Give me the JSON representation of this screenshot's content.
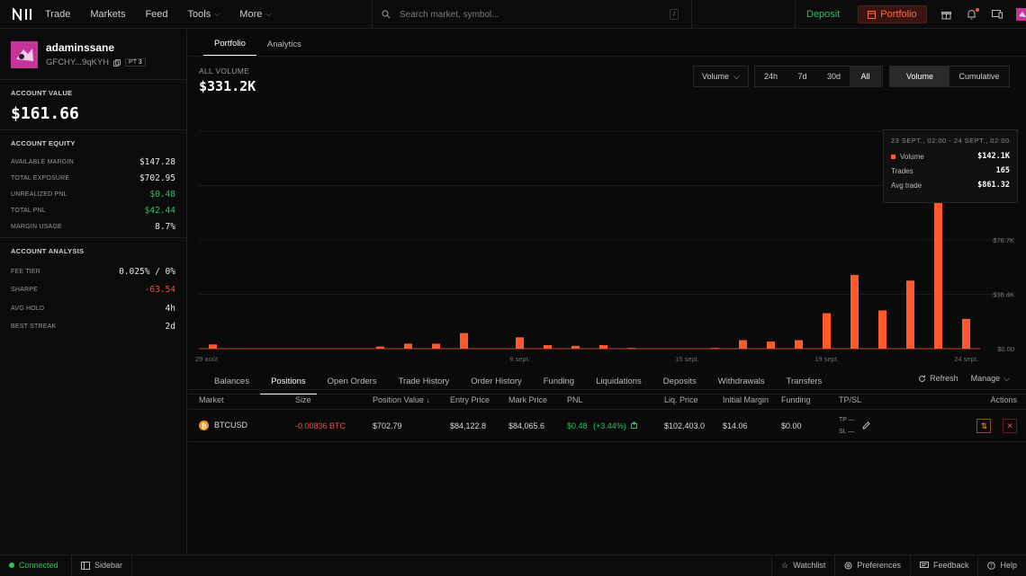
{
  "nav": {
    "items": [
      {
        "label": "Trade"
      },
      {
        "label": "Markets"
      },
      {
        "label": "Feed"
      },
      {
        "label": "Tools"
      },
      {
        "label": "More"
      }
    ],
    "search_placeholder": "Search market, symbol...",
    "search_shortcut": "/",
    "deposit_label": "Deposit",
    "portfolio_label": "Portfolio"
  },
  "profile": {
    "username": "adaminssane",
    "wallet": "GFCHY...9qKYH",
    "pt_label": "PT",
    "pt_value": "3"
  },
  "account": {
    "value_title": "ACCOUNT VALUE",
    "value": "$161.66",
    "equity_title": "ACCOUNT EQUITY",
    "equity_rows": [
      {
        "label": "AVAILABLE MARGIN",
        "value": "$147.28"
      },
      {
        "label": "TOTAL EXPOSURE",
        "value": "$702.95"
      },
      {
        "label": "UNREALIZED PNL",
        "value": "$0.48"
      },
      {
        "label": "TOTAL PNL",
        "value": "$42.44"
      },
      {
        "label": "MARGIN USAGE",
        "value": "8.7%"
      }
    ],
    "analysis_title": "ACCOUNT ANALYSIS",
    "analysis_rows": [
      {
        "label": "FEE TIER",
        "value": "0.025% / 0%"
      },
      {
        "label": "SHARPE",
        "value": "-63.54"
      },
      {
        "label": "AVG HOLD",
        "value": "4h"
      },
      {
        "label": "BEST STREAK",
        "value": "2d"
      }
    ]
  },
  "main": {
    "tabs": [
      {
        "label": "Portfolio"
      },
      {
        "label": "Analytics"
      }
    ],
    "volume_label": "ALL VOLUME",
    "volume_value": "$331.2K",
    "metric_select": "Volume",
    "ranges": [
      {
        "label": "24h"
      },
      {
        "label": "7d"
      },
      {
        "label": "30d"
      },
      {
        "label": "All"
      }
    ],
    "modes": [
      {
        "label": "Volume"
      },
      {
        "label": "Cumulative"
      }
    ]
  },
  "tooltip": {
    "date": "23 SEPT., 02:00 - 24 SEPT., 02:00",
    "rows": [
      {
        "label": "Volume",
        "value": "$142.1K"
      },
      {
        "label": "Trades",
        "value": "165"
      },
      {
        "label": "Avg trade",
        "value": "$861.32"
      }
    ]
  },
  "chart_data": {
    "type": "bar",
    "x_tick_labels": [
      "29 août",
      "9 sept.",
      "15 sept.",
      "19 sept.",
      "24 sept."
    ],
    "y_tick_labels": [
      "$0.00",
      "$38.4K",
      "$76.7K"
    ],
    "ylim": [
      0,
      153400
    ],
    "series_color": "#ff5a2c",
    "values": [
      3000,
      0,
      0,
      0,
      0,
      0,
      1500,
      3500,
      3500,
      11000,
      0,
      8000,
      2500,
      2000,
      2500,
      500,
      0,
      0,
      500,
      6000,
      5000,
      6000,
      25000,
      52000,
      27000,
      48000,
      142100,
      21000
    ]
  },
  "bottom": {
    "tabs": [
      {
        "label": "Balances"
      },
      {
        "label": "Positions"
      },
      {
        "label": "Open Orders"
      },
      {
        "label": "Trade History"
      },
      {
        "label": "Order History"
      },
      {
        "label": "Funding"
      },
      {
        "label": "Liquidations"
      },
      {
        "label": "Deposits"
      },
      {
        "label": "Withdrawals"
      },
      {
        "label": "Transfers"
      }
    ],
    "refresh_label": "Refresh",
    "manage_label": "Manage",
    "columns": [
      "Market",
      "Size",
      "Position Value",
      "Entry Price",
      "Mark Price",
      "PNL",
      "Liq. Price",
      "Initial Margin",
      "Funding",
      "TP/SL",
      "Actions"
    ],
    "sort_indicator": "↓",
    "rows": [
      {
        "market": "BTCUSD",
        "size": "-0.00836 BTC",
        "position_value": "$702.79",
        "entry_price": "$84,122.8",
        "mark_price": "$84,065.6",
        "pnl": "$0.48",
        "pnl_pct": "(+3.44%)",
        "liq_price": "$102,403.0",
        "initial_margin": "$14.06",
        "funding": "$0.00",
        "tp_label": "TP",
        "sl_label": "SL",
        "tp_value": "—",
        "sl_value": "—"
      }
    ]
  },
  "status": {
    "connected": "Connected",
    "sidebar": "Sidebar",
    "watchlist": "Watchlist",
    "preferences": "Preferences",
    "feedback": "Feedback",
    "help": "Help"
  }
}
